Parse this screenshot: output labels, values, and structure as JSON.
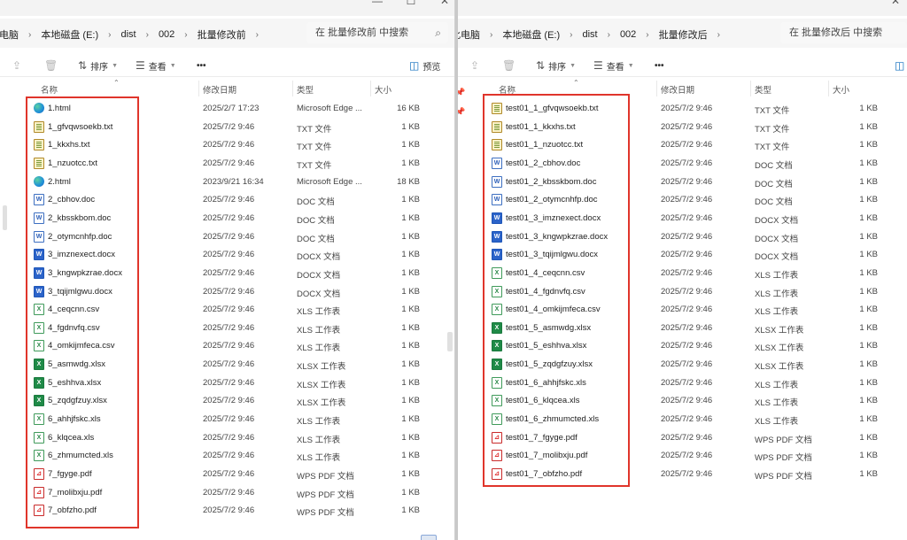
{
  "left": {
    "breadcrumbs": [
      "此电脑",
      "本地磁盘 (E:)",
      "dist",
      "002",
      "批量修改前"
    ],
    "search_placeholder": "在 批量修改前 中搜索",
    "toolbar": {
      "sort": "排序",
      "view": "查看",
      "more": "•••",
      "preview": "预览"
    },
    "columns": {
      "name": "名称",
      "date": "修改日期",
      "type": "类型",
      "size": "大小"
    },
    "files": [
      {
        "name": "1.html",
        "date": "2025/2/7 17:23",
        "type": "Microsoft Edge ...",
        "size": "16 KB",
        "icon": "edge"
      },
      {
        "name": "1_gfvqwsoekb.txt",
        "date": "2025/7/2 9:46",
        "type": "TXT 文件",
        "size": "1 KB",
        "icon": "txt"
      },
      {
        "name": "1_kkxhs.txt",
        "date": "2025/7/2 9:46",
        "type": "TXT 文件",
        "size": "1 KB",
        "icon": "txt"
      },
      {
        "name": "1_nzuotcc.txt",
        "date": "2025/7/2 9:46",
        "type": "TXT 文件",
        "size": "1 KB",
        "icon": "txt"
      },
      {
        "name": "2.html",
        "date": "2023/9/21 16:34",
        "type": "Microsoft Edge ...",
        "size": "18 KB",
        "icon": "edge"
      },
      {
        "name": "2_cbhov.doc",
        "date": "2025/7/2 9:46",
        "type": "DOC 文档",
        "size": "1 KB",
        "icon": "doc"
      },
      {
        "name": "2_kbsskbom.doc",
        "date": "2025/7/2 9:46",
        "type": "DOC 文档",
        "size": "1 KB",
        "icon": "doc"
      },
      {
        "name": "2_otymcnhfp.doc",
        "date": "2025/7/2 9:46",
        "type": "DOC 文档",
        "size": "1 KB",
        "icon": "doc"
      },
      {
        "name": "3_imznexect.docx",
        "date": "2025/7/2 9:46",
        "type": "DOCX 文档",
        "size": "1 KB",
        "icon": "docx"
      },
      {
        "name": "3_kngwpkzrae.docx",
        "date": "2025/7/2 9:46",
        "type": "DOCX 文档",
        "size": "1 KB",
        "icon": "docx"
      },
      {
        "name": "3_tqijmlgwu.docx",
        "date": "2025/7/2 9:46",
        "type": "DOCX 文档",
        "size": "1 KB",
        "icon": "docx"
      },
      {
        "name": "4_ceqcnn.csv",
        "date": "2025/7/2 9:46",
        "type": "XLS 工作表",
        "size": "1 KB",
        "icon": "csv"
      },
      {
        "name": "4_fgdnvfq.csv",
        "date": "2025/7/2 9:46",
        "type": "XLS 工作表",
        "size": "1 KB",
        "icon": "csv"
      },
      {
        "name": "4_omkijmfeca.csv",
        "date": "2025/7/2 9:46",
        "type": "XLS 工作表",
        "size": "1 KB",
        "icon": "csv"
      },
      {
        "name": "5_asmwdg.xlsx",
        "date": "2025/7/2 9:46",
        "type": "XLSX 工作表",
        "size": "1 KB",
        "icon": "xlsx"
      },
      {
        "name": "5_eshhva.xlsx",
        "date": "2025/7/2 9:46",
        "type": "XLSX 工作表",
        "size": "1 KB",
        "icon": "xlsx"
      },
      {
        "name": "5_zqdgfzuy.xlsx",
        "date": "2025/7/2 9:46",
        "type": "XLSX 工作表",
        "size": "1 KB",
        "icon": "xlsx"
      },
      {
        "name": "6_ahhjfskc.xls",
        "date": "2025/7/2 9:46",
        "type": "XLS 工作表",
        "size": "1 KB",
        "icon": "csv"
      },
      {
        "name": "6_klqcea.xls",
        "date": "2025/7/2 9:46",
        "type": "XLS 工作表",
        "size": "1 KB",
        "icon": "csv"
      },
      {
        "name": "6_zhmumcted.xls",
        "date": "2025/7/2 9:46",
        "type": "XLS 工作表",
        "size": "1 KB",
        "icon": "csv"
      },
      {
        "name": "7_fgyge.pdf",
        "date": "2025/7/2 9:46",
        "type": "WPS PDF 文档",
        "size": "1 KB",
        "icon": "pdf"
      },
      {
        "name": "7_molibxju.pdf",
        "date": "2025/7/2 9:46",
        "type": "WPS PDF 文档",
        "size": "1 KB",
        "icon": "pdf"
      },
      {
        "name": "7_obfzho.pdf",
        "date": "2025/7/2 9:46",
        "type": "WPS PDF 文档",
        "size": "1 KB",
        "icon": "pdf"
      }
    ]
  },
  "right": {
    "breadcrumbs": [
      "此电脑",
      "本地磁盘 (E:)",
      "dist",
      "002",
      "批量修改后"
    ],
    "search_placeholder": "在 批量修改后 中搜索",
    "toolbar": {
      "sort": "排序",
      "view": "查看",
      "more": "•••"
    },
    "columns": {
      "name": "名称",
      "date": "修改日期",
      "type": "类型",
      "size": "大小"
    },
    "files": [
      {
        "name": "test01_1_gfvqwsoekb.txt",
        "date": "2025/7/2 9:46",
        "type": "TXT 文件",
        "size": "1 KB",
        "icon": "txt"
      },
      {
        "name": "test01_1_kkxhs.txt",
        "date": "2025/7/2 9:46",
        "type": "TXT 文件",
        "size": "1 KB",
        "icon": "txt"
      },
      {
        "name": "test01_1_nzuotcc.txt",
        "date": "2025/7/2 9:46",
        "type": "TXT 文件",
        "size": "1 KB",
        "icon": "txt"
      },
      {
        "name": "test01_2_cbhov.doc",
        "date": "2025/7/2 9:46",
        "type": "DOC 文档",
        "size": "1 KB",
        "icon": "doc"
      },
      {
        "name": "test01_2_kbsskbom.doc",
        "date": "2025/7/2 9:46",
        "type": "DOC 文档",
        "size": "1 KB",
        "icon": "doc"
      },
      {
        "name": "test01_2_otymcnhfp.doc",
        "date": "2025/7/2 9:46",
        "type": "DOC 文档",
        "size": "1 KB",
        "icon": "doc"
      },
      {
        "name": "test01_3_imznexect.docx",
        "date": "2025/7/2 9:46",
        "type": "DOCX 文档",
        "size": "1 KB",
        "icon": "docx"
      },
      {
        "name": "test01_3_kngwpkzrae.docx",
        "date": "2025/7/2 9:46",
        "type": "DOCX 文档",
        "size": "1 KB",
        "icon": "docx"
      },
      {
        "name": "test01_3_tqijmlgwu.docx",
        "date": "2025/7/2 9:46",
        "type": "DOCX 文档",
        "size": "1 KB",
        "icon": "docx"
      },
      {
        "name": "test01_4_ceqcnn.csv",
        "date": "2025/7/2 9:46",
        "type": "XLS 工作表",
        "size": "1 KB",
        "icon": "csv"
      },
      {
        "name": "test01_4_fgdnvfq.csv",
        "date": "2025/7/2 9:46",
        "type": "XLS 工作表",
        "size": "1 KB",
        "icon": "csv"
      },
      {
        "name": "test01_4_omkijmfeca.csv",
        "date": "2025/7/2 9:46",
        "type": "XLS 工作表",
        "size": "1 KB",
        "icon": "csv"
      },
      {
        "name": "test01_5_asmwdg.xlsx",
        "date": "2025/7/2 9:46",
        "type": "XLSX 工作表",
        "size": "1 KB",
        "icon": "xlsx"
      },
      {
        "name": "test01_5_eshhva.xlsx",
        "date": "2025/7/2 9:46",
        "type": "XLSX 工作表",
        "size": "1 KB",
        "icon": "xlsx"
      },
      {
        "name": "test01_5_zqdgfzuy.xlsx",
        "date": "2025/7/2 9:46",
        "type": "XLSX 工作表",
        "size": "1 KB",
        "icon": "xlsx"
      },
      {
        "name": "test01_6_ahhjfskc.xls",
        "date": "2025/7/2 9:46",
        "type": "XLS 工作表",
        "size": "1 KB",
        "icon": "csv"
      },
      {
        "name": "test01_6_klqcea.xls",
        "date": "2025/7/2 9:46",
        "type": "XLS 工作表",
        "size": "1 KB",
        "icon": "csv"
      },
      {
        "name": "test01_6_zhmumcted.xls",
        "date": "2025/7/2 9:46",
        "type": "XLS 工作表",
        "size": "1 KB",
        "icon": "csv"
      },
      {
        "name": "test01_7_fgyge.pdf",
        "date": "2025/7/2 9:46",
        "type": "WPS PDF 文档",
        "size": "1 KB",
        "icon": "pdf"
      },
      {
        "name": "test01_7_molibxju.pdf",
        "date": "2025/7/2 9:46",
        "type": "WPS PDF 文档",
        "size": "1 KB",
        "icon": "pdf"
      },
      {
        "name": "test01_7_obfzho.pdf",
        "date": "2025/7/2 9:46",
        "type": "WPS PDF 文档",
        "size": "1 KB",
        "icon": "pdf"
      }
    ]
  },
  "icons": {
    "edge": "edge-browser-icon",
    "txt": "text-file-icon",
    "doc": "word-doc-icon",
    "docx": "word-docx-icon",
    "csv": "spreadsheet-csv-icon",
    "xlsx": "excel-xlsx-icon",
    "pdf": "pdf-file-icon"
  },
  "colors": {
    "highlight": "#e0352b",
    "accent": "#0f6cbd"
  }
}
